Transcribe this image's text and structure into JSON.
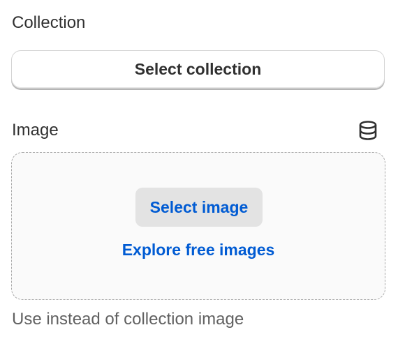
{
  "collection": {
    "label": "Collection",
    "button_label": "Select collection"
  },
  "image": {
    "label": "Image",
    "icon": "database-icon",
    "select_button_label": "Select image",
    "explore_link_label": "Explore free images",
    "help_text": "Use instead of collection image"
  },
  "colors": {
    "text": "#303030",
    "link": "#005bd3",
    "muted": "#616161",
    "dropzone_bg": "#fafafa",
    "dropzone_border": "#a8a8a8"
  }
}
